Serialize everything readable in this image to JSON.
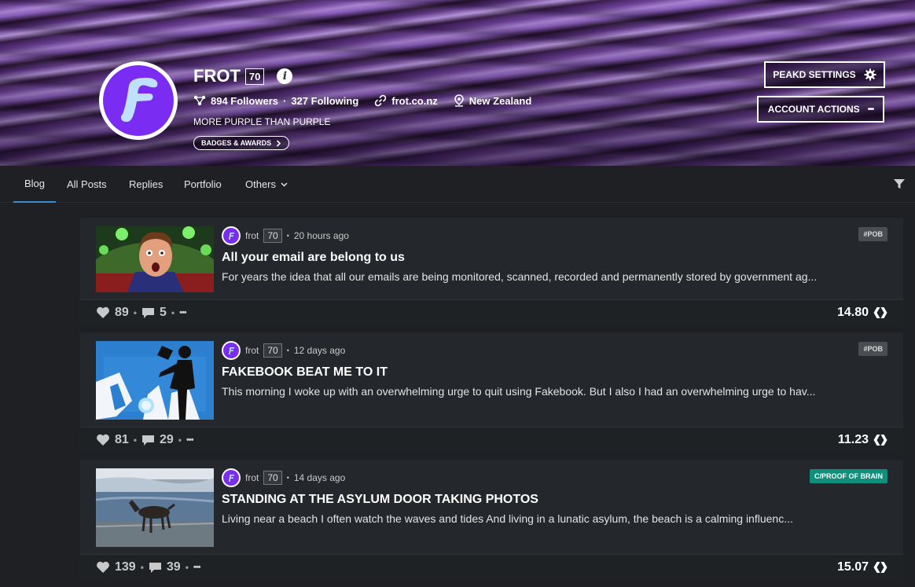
{
  "profile": {
    "name": "FROT",
    "reputation": "70",
    "followers": "894 Followers",
    "following": "327 Following",
    "separator": "·",
    "website": "frot.co.nz",
    "location": "New Zealand",
    "tagline": "MORE PURPLE THAN PURPLE",
    "badges_label": "BADGES & AWARDS"
  },
  "header_buttons": {
    "peakd_settings": "PEAKD SETTINGS",
    "account_actions": "ACCOUNT ACTIONS"
  },
  "nav": {
    "tabs": [
      {
        "label": "Blog",
        "active": true
      },
      {
        "label": "All Posts"
      },
      {
        "label": "Replies"
      },
      {
        "label": "Portfolio"
      },
      {
        "label": "Others"
      }
    ]
  },
  "posts": [
    {
      "author": "frot",
      "rep": "70",
      "time": "20 hours ago",
      "tag": "#POB",
      "title": "All your email are belong to us",
      "excerpt": "For years the idea that all our emails are being monitored, scanned, recorded and permanently stored by government ag...",
      "likes": "89",
      "comments": "5",
      "payout": "14.80"
    },
    {
      "author": "frot",
      "rep": "70",
      "time": "12 days ago",
      "tag": "#POB",
      "title": "FAKEBOOK BEAT ME TO IT",
      "excerpt": "This morning I woke up with an overwhelming urge to quit using Fakebook. But I also I had an overwhelming urge to hav...",
      "likes": "81",
      "comments": "29",
      "payout": "11.23"
    },
    {
      "author": "frot",
      "rep": "70",
      "time": "14 days ago",
      "tag": "C/PROOF OF BRAIN",
      "title": "STANDING AT THE ASYLUM DOOR TAKING PHOTOS",
      "excerpt": "Living near a beach I often watch the waves and tides And living in a lunatic asylum, the beach is a calming influenc...",
      "likes": "139",
      "comments": "39",
      "payout": "15.07"
    }
  ],
  "common": {
    "dot": "•",
    "more": "•••"
  },
  "colors": {
    "accent": "#7b2cf2",
    "tab_underline": "#3a8bd0",
    "community_tag": "#0f8f7c"
  }
}
